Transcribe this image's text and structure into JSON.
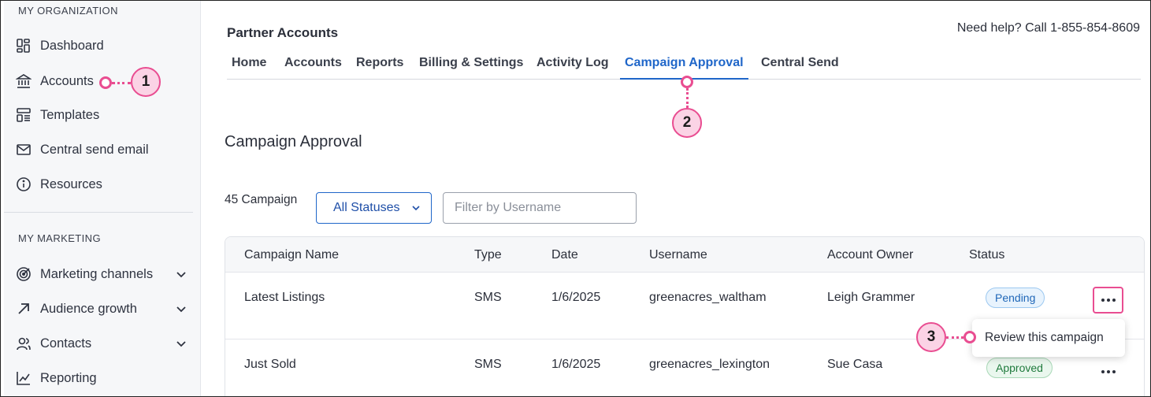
{
  "sidebar": {
    "section1_title": "MY ORGANIZATION",
    "section2_title": "MY MARKETING",
    "items": [
      {
        "label": "Dashboard",
        "icon": "dashboard-icon"
      },
      {
        "label": "Accounts",
        "icon": "bank-icon"
      },
      {
        "label": "Templates",
        "icon": "templates-icon"
      },
      {
        "label": "Central send email",
        "icon": "envelope-icon"
      },
      {
        "label": "Resources",
        "icon": "info-icon"
      },
      {
        "label": "Marketing channels",
        "icon": "target-icon"
      },
      {
        "label": "Audience growth",
        "icon": "arrow-up-right-icon"
      },
      {
        "label": "Contacts",
        "icon": "contacts-icon"
      },
      {
        "label": "Reporting",
        "icon": "chart-icon"
      }
    ]
  },
  "header": {
    "title": "Partner Accounts",
    "help": "Need help? Call 1-855-854-8609"
  },
  "tabs": [
    {
      "label": "Home"
    },
    {
      "label": "Accounts"
    },
    {
      "label": "Reports"
    },
    {
      "label": "Billing & Settings"
    },
    {
      "label": "Activity Log"
    },
    {
      "label": "Campaign Approval",
      "active": true
    },
    {
      "label": "Central Send"
    }
  ],
  "main": {
    "heading": "Campaign Approval",
    "count": "45 Campaign",
    "status_filter": "All Statuses",
    "username_placeholder": "Filter by Username"
  },
  "table": {
    "columns": [
      "Campaign Name",
      "Type",
      "Date",
      "Username",
      "Account Owner",
      "Status"
    ],
    "rows": [
      {
        "name": "Latest Listings",
        "type": "SMS",
        "date": "1/6/2025",
        "username": "greenacres_waltham",
        "owner": "Leigh Grammer",
        "status": "Pending"
      },
      {
        "name": "Just Sold",
        "type": "SMS",
        "date": "1/6/2025",
        "username": "greenacres_lexington",
        "owner": "Sue Casa",
        "status": "Approved"
      }
    ]
  },
  "row_menu": {
    "review": "Review this campaign"
  },
  "callouts": [
    "1",
    "2",
    "3"
  ],
  "colors": {
    "accent": "#1f66c9",
    "callout": "#e94d91",
    "callout_fill": "#fbd3e5",
    "pending": "#2067b8",
    "approved": "#1f7a3c"
  }
}
